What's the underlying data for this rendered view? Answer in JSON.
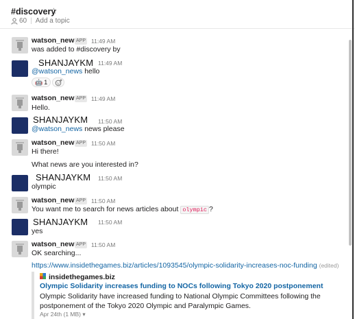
{
  "header": {
    "channel": "#discovery",
    "members": "60",
    "topic": "Add a topic"
  },
  "badge": "APP",
  "messages": [
    {
      "name": "watson_news",
      "time": "11:49 AM",
      "text": "was added to #discovery by"
    },
    {
      "name": "SHANJAYKM",
      "time": "11:49 AM",
      "mention": "@watson_news",
      "text": "hello",
      "reaction": {
        "emoji": "🤖",
        "count": "1"
      }
    },
    {
      "name": "watson_news",
      "time": "11:49 AM",
      "text": "Hello."
    },
    {
      "name": "SHANJAYKM",
      "time": "11:50 AM",
      "mention": "@watson_news",
      "text": "news please"
    },
    {
      "name": "watson_news",
      "time": "11:50 AM",
      "text": "Hi there!",
      "text2": "What news are you interested in?"
    },
    {
      "name": "SHANJAYKM",
      "time": "11:50 AM",
      "text": "olympic"
    },
    {
      "name": "watson_news",
      "time": "11:50 AM",
      "text": "You want me to search for news articles about",
      "code": "olympic",
      "text_end": "?"
    },
    {
      "name": "SHANJAYKM",
      "time": "11:50 AM",
      "text": "yes"
    },
    {
      "name": "watson_news",
      "time": "11:50 AM",
      "text": "OK searching...",
      "link": "https://www.insidethegames.biz/articles/1093545/olympic-solidarity-increases-noc-funding",
      "edited": "(edited)",
      "unfurl": {
        "site": "insidethegames.biz",
        "title": "Olympic Solidarity increases funding to NOCs following Tokyo 2020 postponement",
        "description": "Olympic Solidarity have increased funding to National Olympic Committees following the postponement of the Tokyo 2020 Olympic and Paralympic Games.",
        "meta": "Apr 24th (1 MB) ▾"
      }
    }
  ]
}
